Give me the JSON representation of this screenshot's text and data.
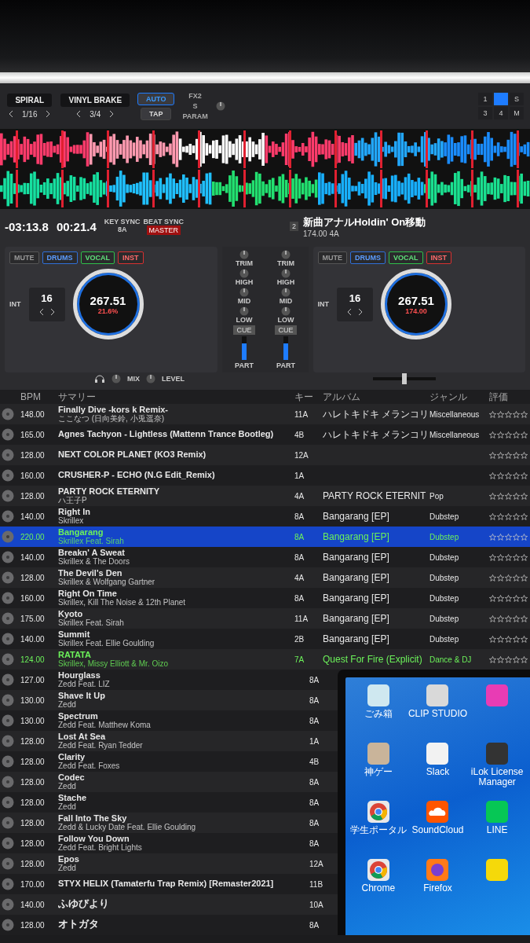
{
  "fx": {
    "effect_1": {
      "name": "SPIRAL",
      "value": "1/16"
    },
    "effect_2": {
      "name": "VINYL BRAKE",
      "value": "3/4"
    },
    "auto": {
      "label": "AUTO",
      "selected": true
    },
    "tap": {
      "label": "TAP",
      "selected": false
    },
    "slot_label": "FX2",
    "s_label": "S",
    "param_label": "PARAM",
    "pads": [
      {
        "label": "1",
        "selected": false
      },
      {
        "selected": true
      },
      {
        "label": "S",
        "selected": false
      },
      {
        "label": "3",
        "selected": false
      },
      {
        "label": "4",
        "selected": false
      },
      {
        "label": "M",
        "selected": false
      }
    ]
  },
  "deck_left": {
    "remaining": "-03:13.8",
    "elapsed": "00:21.4",
    "key_sync": "KEY SYNC",
    "key": "8A",
    "beat_sync": "BEAT SYNC",
    "master": "MASTER",
    "stems": [
      {
        "label": "MUTE",
        "on": false
      },
      {
        "label": "DRUMS",
        "on": true
      },
      {
        "label": "VOCAL",
        "on": true
      },
      {
        "label": "INST",
        "on": true
      }
    ],
    "int": "INT",
    "loop": "16",
    "jog_bpm": "267.51",
    "jog_info": "21.6%"
  },
  "deck_right": {
    "number": "2",
    "title": "新曲アナルHoldin' On移動",
    "bpm_key": "174.00 4A",
    "stems": [
      {
        "label": "MUTE",
        "on": false
      },
      {
        "label": "DRUMS",
        "on": true
      },
      {
        "label": "VOCAL",
        "on": true
      },
      {
        "label": "INST",
        "on": true
      }
    ],
    "int": "INT",
    "loop": "16",
    "jog_bpm": "267.51",
    "jog_info": "174.00"
  },
  "mixer": {
    "channels": [
      {
        "knobs": [
          "TRIM",
          "HIGH",
          "MID",
          "LOW"
        ],
        "cue": "CUE",
        "part": "PART",
        "level": 0.7
      },
      {
        "knobs": [
          "TRIM",
          "HIGH",
          "MID",
          "LOW"
        ],
        "cue": "CUE",
        "part": "PART",
        "level": 0.7
      }
    ],
    "mix_label": "MIX",
    "level_label": "LEVEL",
    "crossfader": {
      "level": 0.5
    }
  },
  "browser": {
    "columns": [
      "BPM",
      "サマリー",
      "キー",
      "アルバム",
      "ジャンル",
      "評価"
    ],
    "rows": [
      {
        "bpm": "148.00",
        "title": "Finally Dive -kors k Remix-",
        "artist": "ここなつ (日向美鈴, 小兎遥奈)",
        "key": "11A",
        "album": "ハレトキドキ メランコリ",
        "genre": "Miscellaneous",
        "stars": 0,
        "selected": false,
        "loaded": false
      },
      {
        "bpm": "165.00",
        "title": "Agnes Tachyon - Lightless (Mattenn Trance Bootleg)",
        "key": "4B",
        "album": "ハレトキドキ メランコリ",
        "genre": "Miscellaneous",
        "stars": 0,
        "selected": false,
        "loaded": false
      },
      {
        "bpm": "128.00",
        "title": "NEXT COLOR PLANET (KO3 Remix)",
        "key": "12A",
        "stars": 0,
        "selected": false,
        "loaded": false
      },
      {
        "bpm": "160.00",
        "title": "CRUSHER-P - ECHO (N.G Edit_Remix)",
        "key": "1A",
        "stars": 0,
        "selected": false,
        "loaded": false
      },
      {
        "bpm": "128.00",
        "title": "PARTY ROCK ETERNITY",
        "artist": "ハ王子P",
        "key": "4A",
        "album": "PARTY ROCK ETERNIT",
        "genre": "Pop",
        "stars": 0,
        "selected": false,
        "loaded": false
      },
      {
        "bpm": "140.00",
        "title": "Right In",
        "artist": "Skrillex",
        "key": "8A",
        "album": "Bangarang [EP]",
        "genre": "Dubstep",
        "stars": 0,
        "selected": false,
        "loaded": false
      },
      {
        "bpm": "220.00",
        "title": "Bangarang",
        "artist": "Skrillex Feat. Sirah",
        "key": "8A",
        "album": "Bangarang [EP]",
        "genre": "Dubstep",
        "stars": 0,
        "selected": true,
        "loaded": true
      },
      {
        "bpm": "140.00",
        "title": "Breakn' A Sweat",
        "artist": "Skrillex & The Doors",
        "key": "8A",
        "album": "Bangarang [EP]",
        "genre": "Dubstep",
        "stars": 0,
        "selected": false,
        "loaded": false
      },
      {
        "bpm": "128.00",
        "title": "The Devil's Den",
        "artist": "Skrillex & Wolfgang Gartner",
        "key": "4A",
        "album": "Bangarang [EP]",
        "genre": "Dubstep",
        "stars": 0,
        "selected": false,
        "loaded": false
      },
      {
        "bpm": "160.00",
        "title": "Right On Time",
        "artist": "Skrillex, Kill The Noise & 12th Planet",
        "key": "8A",
        "album": "Bangarang [EP]",
        "genre": "Dubstep",
        "stars": 0,
        "selected": false,
        "loaded": false
      },
      {
        "bpm": "175.00",
        "title": "Kyoto",
        "artist": "Skrillex Feat. Sirah",
        "key": "11A",
        "album": "Bangarang [EP]",
        "genre": "Dubstep",
        "stars": 0,
        "selected": false,
        "loaded": false
      },
      {
        "bpm": "140.00",
        "title": "Summit",
        "artist": "Skrillex Feat. Ellie Goulding",
        "key": "2B",
        "album": "Bangarang [EP]",
        "genre": "Dubstep",
        "stars": 0,
        "selected": false,
        "loaded": false
      },
      {
        "bpm": "124.00",
        "title": "RATATA",
        "artist": "Skrillex, Missy Elliott & Mr. Oizo",
        "key": "7A",
        "album": "Quest For Fire (Explicit)",
        "genre": "Dance & DJ",
        "stars": 0,
        "selected": false,
        "loaded": true
      },
      {
        "bpm": "127.00",
        "title": "Hourglass",
        "artist": "Zedd Feat. LIZ",
        "key": "8A",
        "selected": false,
        "loaded": false
      },
      {
        "bpm": "130.00",
        "title": "Shave It Up",
        "artist": "Zedd",
        "key": "8A",
        "selected": false,
        "loaded": false
      },
      {
        "bpm": "130.00",
        "title": "Spectrum",
        "artist": "Zedd Feat. Matthew Koma",
        "key": "8A",
        "selected": false,
        "loaded": false
      },
      {
        "bpm": "128.00",
        "title": "Lost At Sea",
        "artist": "Zedd Feat. Ryan Tedder",
        "key": "1A",
        "selected": false,
        "loaded": false
      },
      {
        "bpm": "128.00",
        "title": "Clarity",
        "artist": "Zedd Feat. Foxes",
        "key": "4B",
        "selected": false,
        "loaded": false
      },
      {
        "bpm": "128.00",
        "title": "Codec",
        "artist": "Zedd",
        "key": "8A",
        "selected": false,
        "loaded": false
      },
      {
        "bpm": "128.00",
        "title": "Stache",
        "artist": "Zedd",
        "key": "8A",
        "selected": false,
        "loaded": false
      },
      {
        "bpm": "128.00",
        "title": "Fall Into The Sky",
        "artist": "Zedd & Lucky Date Feat. Ellie Goulding",
        "key": "8A",
        "selected": false,
        "loaded": false
      },
      {
        "bpm": "128.00",
        "title": "Follow You Down",
        "artist": "Zedd Feat. Bright Lights",
        "key": "8A",
        "selected": false,
        "loaded": false
      },
      {
        "bpm": "128.00",
        "title": "Epos",
        "artist": "Zedd",
        "key": "12A",
        "selected": false,
        "loaded": false
      },
      {
        "bpm": "170.00",
        "title": "STYX HELIX (Tamaterfu Trap Remix) [Remaster2021]",
        "key": "11B",
        "selected": false,
        "loaded": false
      },
      {
        "bpm": "140.00",
        "title": "ふゆびより",
        "key": "10A",
        "selected": false,
        "loaded": false
      },
      {
        "bpm": "128.00",
        "title": "オトガタ",
        "key": "8A",
        "selected": false,
        "loaded": false
      }
    ]
  },
  "desktop": {
    "icons": [
      {
        "label": "ごみ箱",
        "kind": "trash",
        "color": "#cfe8f0"
      },
      {
        "label": "CLIP STUDIO",
        "kind": "clip",
        "color": "#d9d9d9"
      },
      {
        "kind": "art",
        "color": "#e83cb4"
      },
      {
        "label": "神ゲー",
        "kind": "block",
        "color": "#c9b49a"
      },
      {
        "label": "Slack",
        "kind": "slack",
        "color": "#f2f2f2"
      },
      {
        "label": "iLok License Manager",
        "kind": "ilok",
        "color": "#333333"
      },
      {
        "label": "学生ポータル",
        "kind": "chrome",
        "color": "#e8e8e8"
      },
      {
        "label": "SoundCloud",
        "kind": "cloud",
        "color": "#ff5500"
      },
      {
        "label": "LINE",
        "kind": "chat",
        "color": "#06c755"
      },
      {
        "label": "Chrome",
        "kind": "chrome",
        "color": "#e8e8e8"
      },
      {
        "label": "Firefox",
        "kind": "fox",
        "color": "#ff7a18"
      },
      {
        "kind": "memo",
        "color": "#f5d90a"
      }
    ]
  }
}
